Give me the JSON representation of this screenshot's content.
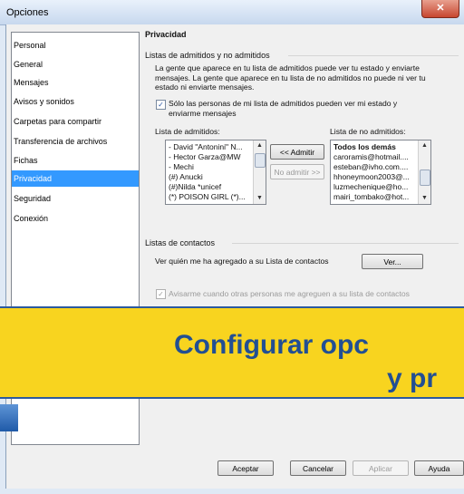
{
  "window": {
    "title": "Opciones",
    "close_glyph": "✕"
  },
  "sidebar": {
    "items": [
      {
        "label": "Personal"
      },
      {
        "label": "General"
      },
      {
        "label": "Mensajes"
      },
      {
        "label": "Avisos y sonidos"
      },
      {
        "label": "Carpetas para compartir"
      },
      {
        "label": "Transferencia de archivos"
      },
      {
        "label": "Fichas"
      },
      {
        "label": "Privacidad",
        "selected": true
      },
      {
        "label": "Seguridad"
      },
      {
        "label": "Conexión"
      }
    ]
  },
  "privacy": {
    "heading": "Privacidad",
    "group_allow": {
      "title": "Listas de admitidos y no admitidos",
      "description": "La gente que aparece en tu lista de admitidos puede ver tu estado y enviarte mensajes. La gente que aparece en tu lista de no admitidos no puede ni ver tu estado ni enviarte mensajes.",
      "only_allowed_checkbox": {
        "checked": true,
        "label": "Sólo las personas de mi lista de admitidos pueden ver mi estado y enviarme mensajes"
      },
      "allow_list": {
        "label": "Lista de admitidos:",
        "items": [
          "- David \"Antonini\" N...",
          "- Hector Garza@MW",
          "- Mechi",
          "(#) Anucki",
          "(#)Nilda *unicef",
          "(*) POISON GIRL (*)..."
        ]
      },
      "block_list": {
        "label": "Lista de no admitidos:",
        "items": [
          "Todos los demás",
          "caroramis@hotmail....",
          "esteban@ivho.com....",
          "hhoneymoon2003@...",
          "luzmechenique@ho...",
          "mairi_tombako@hot..."
        ]
      },
      "admit_button": "<< Admitir",
      "block_button": "No admitir >>"
    },
    "group_contacts": {
      "title": "Listas de contactos",
      "who_added_label": "Ver quién me ha agregado a su Lista de contactos",
      "view_button": "Ver...",
      "notify_checkbox": {
        "checked": true,
        "enabled": false,
        "label": "Avisarme cuando otras personas me agreguen a su lista de contactos"
      }
    }
  },
  "banner": {
    "line1": "Configurar opc",
    "line2": "y pr",
    "color_bg": "#f8d41f",
    "color_text": "#224f93"
  },
  "footer": {
    "ok": "Aceptar",
    "cancel": "Cancelar",
    "apply": "Aplicar",
    "help": "Ayuda"
  },
  "glyphs": {
    "check": "✓",
    "up": "▲",
    "down": "▼"
  }
}
